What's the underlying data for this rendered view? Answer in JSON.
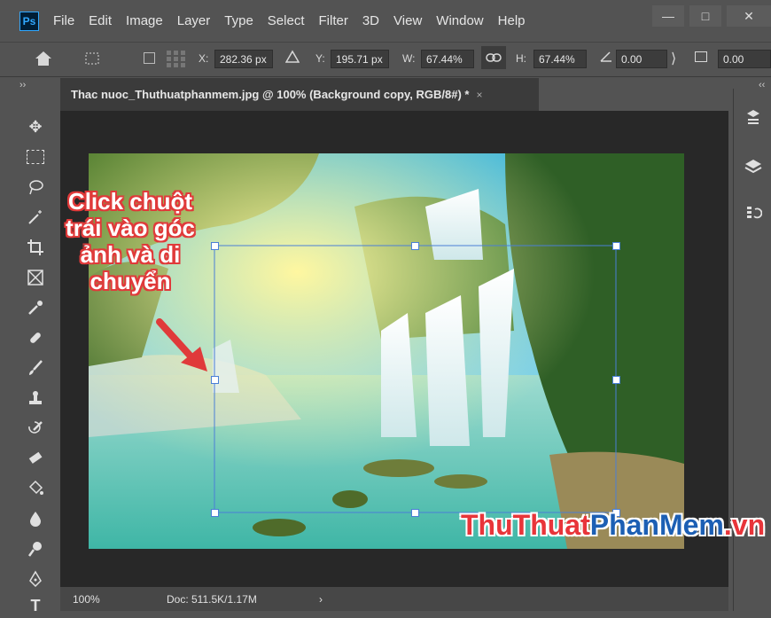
{
  "app": {
    "logo": "Ps"
  },
  "menu": [
    "File",
    "Edit",
    "Image",
    "Layer",
    "Type",
    "Select",
    "Filter",
    "3D",
    "View",
    "Window",
    "Help"
  ],
  "window_controls": {
    "minimize": "—",
    "maximize": "□",
    "close": "✕"
  },
  "options": {
    "x_label": "X:",
    "x_value": "282.36 px",
    "y_label": "Y:",
    "y_value": "195.71 px",
    "w_label": "W:",
    "w_value": "67.44%",
    "h_label": "H:",
    "h_value": "67.44%",
    "angle_value": "0.00",
    "skew_value": "0.00"
  },
  "document_tab": {
    "title": "Thac nuoc_Thuthuatphanmem.jpg @ 100% (Background copy, RGB/8#) *",
    "close": "×"
  },
  "status": {
    "zoom": "100%",
    "doc": "Doc: 511.5K/1.17M"
  },
  "annotation": {
    "lines": [
      "Click chuột",
      "trái vào góc",
      "ảnh và di",
      "chuyển"
    ]
  },
  "watermark": {
    "part1": "ThuThuat",
    "part2": "PhanMem",
    "part3": ".vn"
  },
  "colors": {
    "accent": "#e03a3a",
    "watermark_red": "#e8353a",
    "watermark_blue": "#1c5fb4",
    "selection": "#4a7fd6"
  }
}
